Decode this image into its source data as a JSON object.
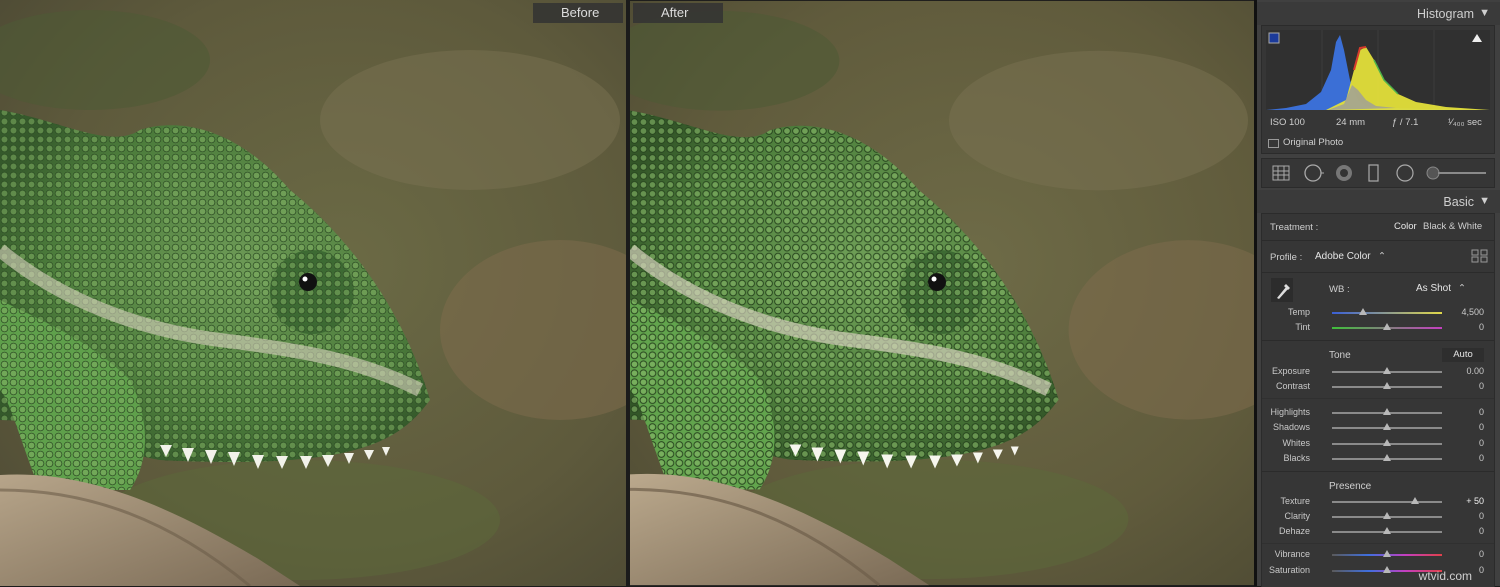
{
  "compare": {
    "before_label": "Before",
    "after_label": "After"
  },
  "histogram": {
    "title": "Histogram",
    "iso": "ISO 100",
    "focal": "24 mm",
    "aperture": "ƒ / 7.1",
    "shutter": "¹⁄₄₀₀ sec",
    "original_photo": "Original Photo",
    "colors": {
      "blue": "#3b6fd6",
      "yellow": "#e3df3a",
      "red": "#d63a2b",
      "green": "#4fb34a"
    }
  },
  "tools": [
    "crop-grid-icon",
    "spot-removal-icon",
    "red-eye-icon",
    "graduated-filter-icon",
    "radial-filter-icon",
    "adjustment-brush-icon"
  ],
  "basic": {
    "title": "Basic",
    "treatment_label": "Treatment :",
    "treatment_color": "Color",
    "treatment_bw": "Black & White",
    "profile_label": "Profile :",
    "profile_value": "Adobe Color",
    "wb_label": "WB :",
    "wb_value": "As Shot",
    "tone_label": "Tone",
    "auto_label": "Auto",
    "presence_label": "Presence",
    "sliders": {
      "temp": {
        "label": "Temp",
        "value": "4,500",
        "pos": 0.28
      },
      "tint": {
        "label": "Tint",
        "value": "0",
        "pos": 0.5
      },
      "exposure": {
        "label": "Exposure",
        "value": "0.00",
        "pos": 0.5
      },
      "contrast": {
        "label": "Contrast",
        "value": "0",
        "pos": 0.5
      },
      "highlights": {
        "label": "Highlights",
        "value": "0",
        "pos": 0.5
      },
      "shadows": {
        "label": "Shadows",
        "value": "0",
        "pos": 0.5
      },
      "whites": {
        "label": "Whites",
        "value": "0",
        "pos": 0.5
      },
      "blacks": {
        "label": "Blacks",
        "value": "0",
        "pos": 0.5
      },
      "texture": {
        "label": "Texture",
        "value": "+ 50",
        "pos": 0.75
      },
      "clarity": {
        "label": "Clarity",
        "value": "0",
        "pos": 0.5
      },
      "dehaze": {
        "label": "Dehaze",
        "value": "0",
        "pos": 0.5
      },
      "vibrance": {
        "label": "Vibrance",
        "value": "0",
        "pos": 0.5
      },
      "saturation": {
        "label": "Saturation",
        "value": "0",
        "pos": 0.5
      }
    }
  },
  "watermark": "wtvid.com"
}
